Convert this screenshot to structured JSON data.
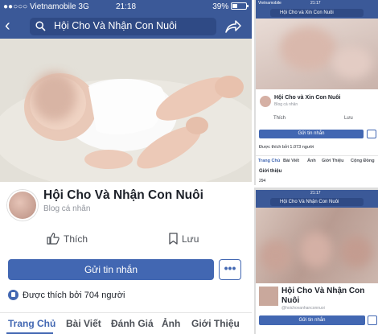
{
  "main": {
    "status": {
      "carrier": "Vietnamobile",
      "network": "3G",
      "time": "21:18",
      "battery": "39%"
    },
    "search": {
      "query": "Hội Cho Và Nhận Con Nuôi"
    },
    "page": {
      "title": "Hội Cho Và Nhận Con Nuôi",
      "subtitle": "Blog cá nhân"
    },
    "actions": {
      "like_label": "Thích",
      "save_label": "Lưu"
    },
    "message_button": "Gửi tin nhắn",
    "more_label": "•••",
    "liked_by": "Được thích bởi 704 người",
    "tabs": [
      "Trang Chủ",
      "Bài Viết",
      "Đánh Giá",
      "Ảnh",
      "Giới Thiệu"
    ]
  },
  "right_top": {
    "status": {
      "carrier": "Vietnamobile",
      "time": "21:17"
    },
    "search": {
      "query": "Hội Cho và Xin Con Nuôi"
    },
    "page": {
      "title": "Hội Cho và Xin Con Nuôi",
      "subtitle": "Blog cá nhân"
    },
    "actions": {
      "like_label": "Thích",
      "save_label": "Lưu"
    },
    "message_button": "Gửi tin nhắn",
    "liked_by": "Được thích bởi 1.073 người",
    "tabs": [
      "Trang Chủ",
      "Bài Viết",
      "Ảnh",
      "Giới Thiệu",
      "Cộng Đồng"
    ],
    "intro_heading": "Giới thiệu",
    "intro_count": "294"
  },
  "right_bottom": {
    "status": {
      "time": "21:17"
    },
    "search": {
      "query": "Hội Cho Và Nhận Con Nuôi"
    },
    "page": {
      "title": "Hội Cho Và Nhận Con Nuôi",
      "subtitle": "@hoichovanhanconnuoi"
    },
    "message_button": "Gửi tin nhắn"
  },
  "colors": {
    "facebook_blue": "#3b5998",
    "button_blue": "#4267b2"
  }
}
